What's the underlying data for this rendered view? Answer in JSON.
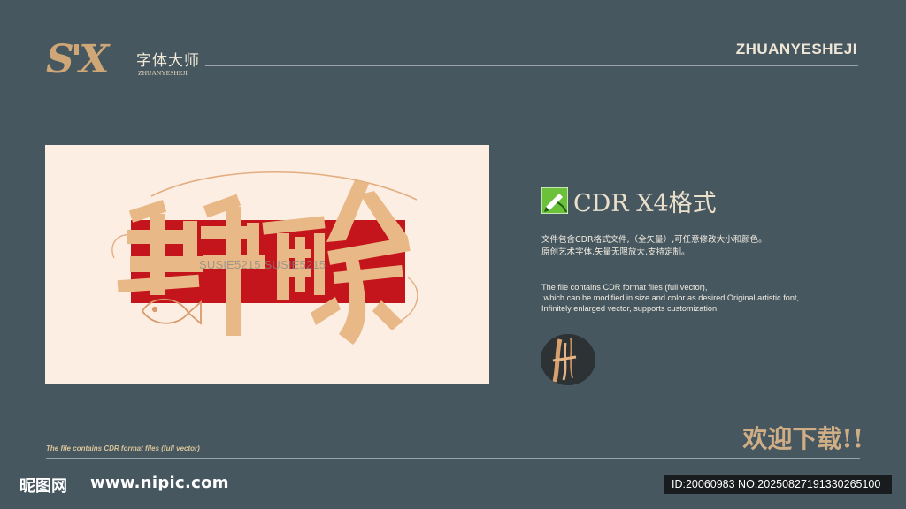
{
  "header": {
    "logo_brand": "S'X",
    "logo_cn": "字体大师",
    "logo_en": "ZHUANYESHEJI",
    "right_text": "ZHUANYESHEJI"
  },
  "artwork": {
    "calligraphy_text": "年年有余",
    "watermark": "SUSIE5215 SUSIE5215",
    "colors": {
      "background": "#fdeee4",
      "red_block": "#c4151c",
      "glyph": "#e9b887"
    }
  },
  "info": {
    "format_title": "CDR X4格式",
    "desc_cn_line1": "文件包含CDR格式文件,（全矢量）,可任意修改大小和颜色。",
    "desc_cn_line2": "原创艺术字体,矢量无限放大,支持定制。",
    "desc_en_line1": "The file contains CDR format files (full vector),",
    "desc_en_line2": " which can be modified in size and color as desired.Original artistic font,",
    "desc_en_line3": "Infinitely enlarged vector, supports customization."
  },
  "bottom": {
    "en_note": "The file contains CDR format files (full vector)",
    "download_text": "欢迎下载!!"
  },
  "footer": {
    "site_cn": "昵图网",
    "site_url": "www.nipic.com",
    "id_text": "ID:20060983 NO:20250827191330265100"
  },
  "colors": {
    "page_bg": "#465760",
    "accent_gold": "#cfae86",
    "text_light": "#f2ece1"
  },
  "icons": [
    "corel-draw-icon",
    "brush-thumbnail"
  ]
}
